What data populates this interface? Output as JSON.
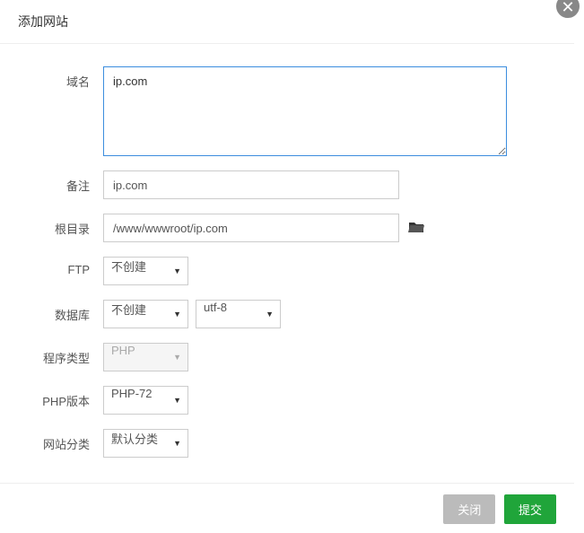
{
  "dialog": {
    "title": "添加网站",
    "closeIcon": "✕"
  },
  "form": {
    "domain": {
      "label": "域名",
      "value": "ip.com"
    },
    "remark": {
      "label": "备注",
      "value": "ip.com"
    },
    "root": {
      "label": "根目录",
      "value": "/www/wwwroot/ip.com"
    },
    "ftp": {
      "label": "FTP",
      "value": "不创建"
    },
    "database": {
      "label": "数据库",
      "value": "不创建",
      "charset": "utf-8"
    },
    "programType": {
      "label": "程序类型",
      "value": "PHP"
    },
    "phpVersion": {
      "label": "PHP版本",
      "value": "PHP-72"
    },
    "siteCategory": {
      "label": "网站分类",
      "value": "默认分类"
    }
  },
  "footer": {
    "cancel": "关闭",
    "submit": "提交"
  }
}
